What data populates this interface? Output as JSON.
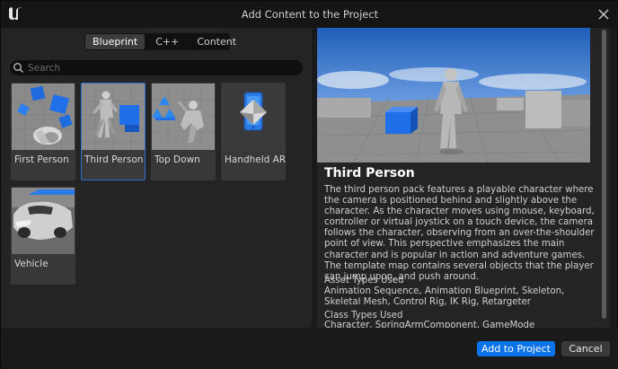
{
  "window": {
    "title": "Add Content to the Project",
    "logo_icon": "unreal-logo-icon",
    "close_icon": "close-icon"
  },
  "tabs": [
    {
      "label": "Blueprint",
      "active": true
    },
    {
      "label": "C++",
      "active": false
    },
    {
      "label": "Content",
      "active": false
    }
  ],
  "search": {
    "placeholder": "Search",
    "value": ""
  },
  "templates": [
    {
      "label": "First Person",
      "selected": false
    },
    {
      "label": "Third Person",
      "selected": true
    },
    {
      "label": "Top Down",
      "selected": false
    },
    {
      "label": "Handheld AR",
      "selected": false
    },
    {
      "label": "Vehicle",
      "selected": false
    }
  ],
  "details": {
    "title": "Third Person",
    "description": "The third person pack features a playable character where the camera is positioned behind and slightly above the character. As the character moves using mouse, keyboard, controller or virtual joystick on a touch device, the camera follows the character, observing from an over-the-shoulder point of view. This perspective emphasizes the main character and is popular in action and adventure games. The template map contains several objects that the player can jump upon, and push around.",
    "asset_types_heading": "Asset Types Used",
    "asset_types": "Animation Sequence, Animation Blueprint, Skeleton, Skeletal Mesh, Control Rig, IK Rig, Retargeter",
    "class_types_heading": "Class Types Used",
    "class_types": "Character, SpringArmComponent, GameMode"
  },
  "footer": {
    "add_label": "Add to Project",
    "cancel_label": "Cancel"
  },
  "colors": {
    "accent": "#0a73e8",
    "selected_border": "#2f6fd0",
    "panel": "#242424",
    "background": "#1a1a1a"
  }
}
